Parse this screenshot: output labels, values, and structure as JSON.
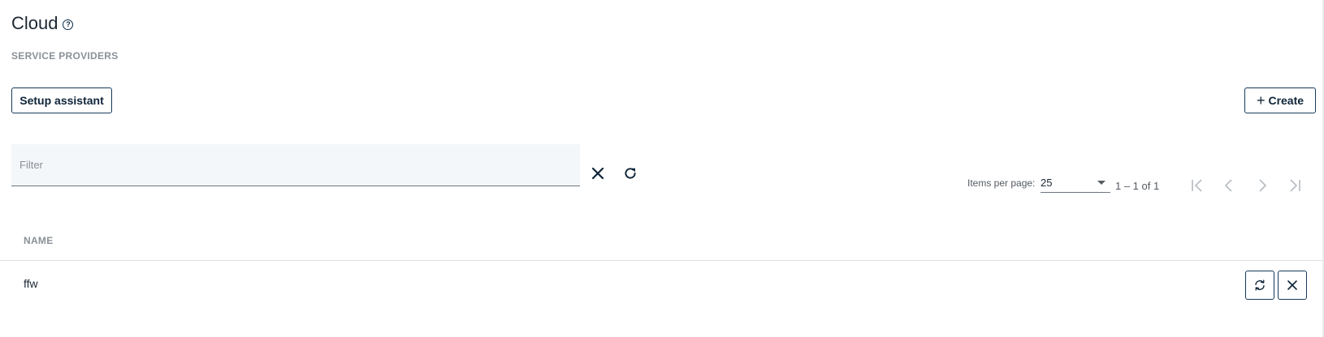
{
  "header": {
    "title": "Cloud",
    "help_icon": "help-circle-icon",
    "subtitle": "SERVICE PROVIDERS"
  },
  "toolbar": {
    "setup_label": "Setup assistant",
    "create_label": "Create",
    "create_icon": "plus-icon"
  },
  "filter": {
    "placeholder": "Filter",
    "value": "",
    "clear_icon": "close-icon",
    "refresh_icon": "refresh-icon"
  },
  "pagination": {
    "items_per_page_label": "Items per page:",
    "items_per_page_value": "25",
    "range_text": "1 – 1 of 1",
    "icons": [
      "first-page-icon",
      "previous-page-icon",
      "next-page-icon",
      "last-page-icon"
    ]
  },
  "table": {
    "columns": [
      "NAME"
    ],
    "rows": [
      {
        "name": "ffw",
        "actions": [
          "sync-icon",
          "close-icon"
        ]
      }
    ]
  },
  "colors": {
    "accent": "#0e2438",
    "muted_text": "#8b9197",
    "filter_bg": "#f4f7f9",
    "border": "#173a5a"
  }
}
